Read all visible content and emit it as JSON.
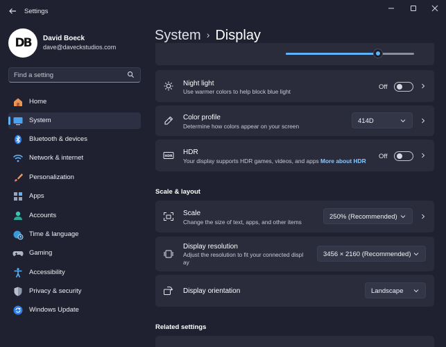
{
  "window": {
    "title": "Settings"
  },
  "profile": {
    "name": "David Boeck",
    "email": "dave@daveckstudios.com",
    "initials": "DB"
  },
  "search": {
    "placeholder": "Find a setting"
  },
  "nav": [
    {
      "label": "Home",
      "icon": "home-icon"
    },
    {
      "label": "System",
      "icon": "system-icon",
      "active": true
    },
    {
      "label": "Bluetooth & devices",
      "icon": "bluetooth-icon"
    },
    {
      "label": "Network & internet",
      "icon": "wifi-icon"
    },
    {
      "label": "Personalization",
      "icon": "brush-icon"
    },
    {
      "label": "Apps",
      "icon": "apps-icon"
    },
    {
      "label": "Accounts",
      "icon": "accounts-icon"
    },
    {
      "label": "Time & language",
      "icon": "globe-clock-icon"
    },
    {
      "label": "Gaming",
      "icon": "gamepad-icon"
    },
    {
      "label": "Accessibility",
      "icon": "accessibility-icon"
    },
    {
      "label": "Privacy & security",
      "icon": "shield-icon"
    },
    {
      "label": "Windows Update",
      "icon": "update-icon"
    }
  ],
  "header": {
    "parent": "System",
    "separator": "›",
    "current": "Display"
  },
  "brightness": {
    "value_fraction": 0.72
  },
  "night_light": {
    "title": "Night light",
    "desc": "Use warmer colors to help block blue light",
    "state": "Off"
  },
  "color_profile": {
    "title": "Color profile",
    "desc": "Determine how colors appear on your screen",
    "value": "414D"
  },
  "hdr": {
    "title": "HDR",
    "desc": "Your display supports HDR games, videos, and apps",
    "link": "More about HDR",
    "state": "Off"
  },
  "scale_layout": {
    "header": "Scale & layout"
  },
  "scale": {
    "title": "Scale",
    "desc": "Change the size of text, apps, and other items",
    "value": "250% (Recommended)"
  },
  "resolution": {
    "title": "Display resolution",
    "desc_line1": "Adjust the resolution to fit your connected displ",
    "desc_line2": "ay",
    "value": "3456 × 2160 (Recommended)"
  },
  "orientation": {
    "title": "Display orientation",
    "value": "Landscape"
  },
  "related": {
    "header": "Related settings"
  },
  "colors": {
    "accent": "#5fb2f7",
    "background": "#1f2130",
    "card": "#2a2c3b"
  }
}
